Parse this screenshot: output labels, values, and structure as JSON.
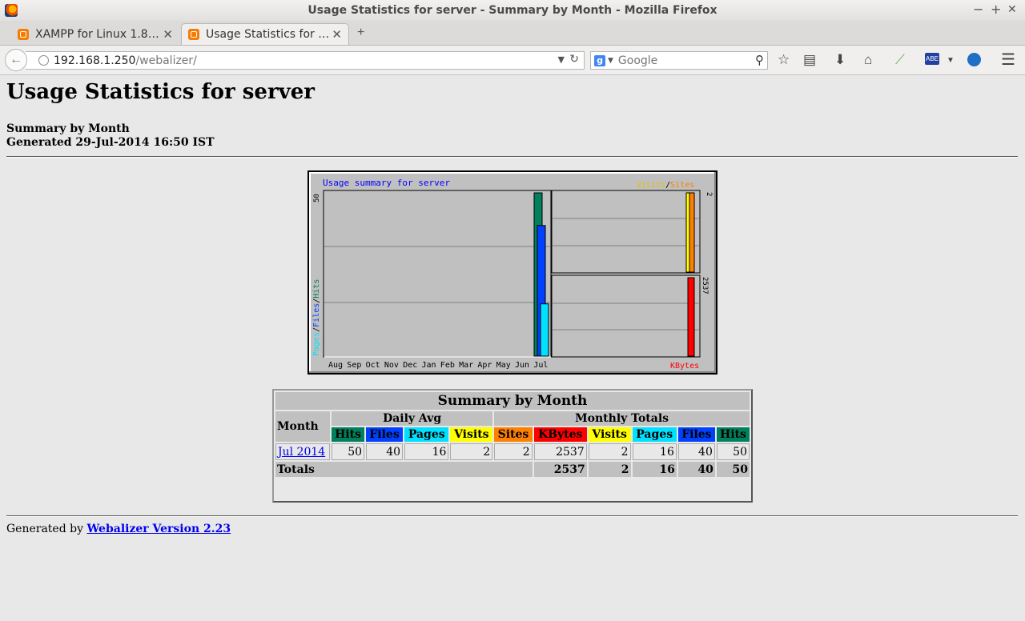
{
  "window": {
    "title": "Usage Statistics for server - Summary by Month - Mozilla Firefox",
    "min": "−",
    "max": "+",
    "close": "✕"
  },
  "tabs": [
    {
      "label": "XAMPP for Linux 1.8…"
    },
    {
      "label": "Usage Statistics for …"
    }
  ],
  "nav": {
    "url_host": "192.168.1.250",
    "url_path": "/webalizer/",
    "search_placeholder": "Google",
    "search_engine": "g"
  },
  "page": {
    "title": "Usage Statistics for server",
    "subtitle": "Summary by Month",
    "generated": "Generated 29-Jul-2014 16:50 IST"
  },
  "chart_data": {
    "type": "bar",
    "title": "Usage summary for server",
    "categories": [
      "Aug",
      "Sep",
      "Oct",
      "Nov",
      "Dec",
      "Jan",
      "Feb",
      "Mar",
      "Apr",
      "May",
      "Jun",
      "Jul"
    ],
    "left_panel": {
      "ymax": 50,
      "labels": [
        "Pages",
        "/",
        "Files",
        "/",
        "Hits"
      ],
      "series": [
        {
          "name": "Hits",
          "color": "#00805c",
          "values": [
            0,
            0,
            0,
            0,
            0,
            0,
            0,
            0,
            0,
            0,
            0,
            50
          ]
        },
        {
          "name": "Files",
          "color": "#0040ff",
          "values": [
            0,
            0,
            0,
            0,
            0,
            0,
            0,
            0,
            0,
            0,
            0,
            40
          ]
        },
        {
          "name": "Pages",
          "color": "#00e0ff",
          "values": [
            0,
            0,
            0,
            0,
            0,
            0,
            0,
            0,
            0,
            0,
            0,
            16
          ]
        }
      ]
    },
    "top_right_panel": {
      "ymax": 2,
      "labels": [
        "Visits",
        "/",
        "Sites"
      ],
      "series": [
        {
          "name": "Visits",
          "color": "#ffff00",
          "values": [
            0,
            0,
            0,
            0,
            0,
            0,
            0,
            0,
            0,
            0,
            0,
            2
          ]
        },
        {
          "name": "Sites",
          "color": "#ff8000",
          "values": [
            0,
            0,
            0,
            0,
            0,
            0,
            0,
            0,
            0,
            0,
            0,
            2
          ]
        }
      ]
    },
    "bottom_right_panel": {
      "ymax": 2537,
      "label": "KBytes",
      "series": [
        {
          "name": "KBytes",
          "color": "#ff0000",
          "values": [
            0,
            0,
            0,
            0,
            0,
            0,
            0,
            0,
            0,
            0,
            0,
            2537
          ]
        }
      ]
    }
  },
  "summary": {
    "caption": "Summary by Month",
    "month_header": "Month",
    "daily_avg_header": "Daily Avg",
    "monthly_totals_header": "Monthly Totals",
    "daily_cols": [
      {
        "label": "Hits",
        "color": "#00805c"
      },
      {
        "label": "Files",
        "color": "#0040ff"
      },
      {
        "label": "Pages",
        "color": "#00e0ff"
      },
      {
        "label": "Visits",
        "color": "#ffff00"
      }
    ],
    "monthly_cols": [
      {
        "label": "Sites",
        "color": "#ff8000"
      },
      {
        "label": "KBytes",
        "color": "#ff0000"
      },
      {
        "label": "Visits",
        "color": "#ffff00"
      },
      {
        "label": "Pages",
        "color": "#00e0ff"
      },
      {
        "label": "Files",
        "color": "#0040ff"
      },
      {
        "label": "Hits",
        "color": "#00805c"
      }
    ],
    "rows": [
      {
        "month": "Jul 2014",
        "daily": [
          "50",
          "40",
          "16",
          "2"
        ],
        "monthly": [
          "2",
          "2537",
          "2",
          "16",
          "40",
          "50"
        ]
      }
    ],
    "totals": {
      "label": "Totals",
      "values": [
        "2537",
        "2",
        "16",
        "40",
        "50"
      ]
    }
  },
  "footer": {
    "prefix": "Generated by",
    "link": "Webalizer Version 2.23"
  }
}
